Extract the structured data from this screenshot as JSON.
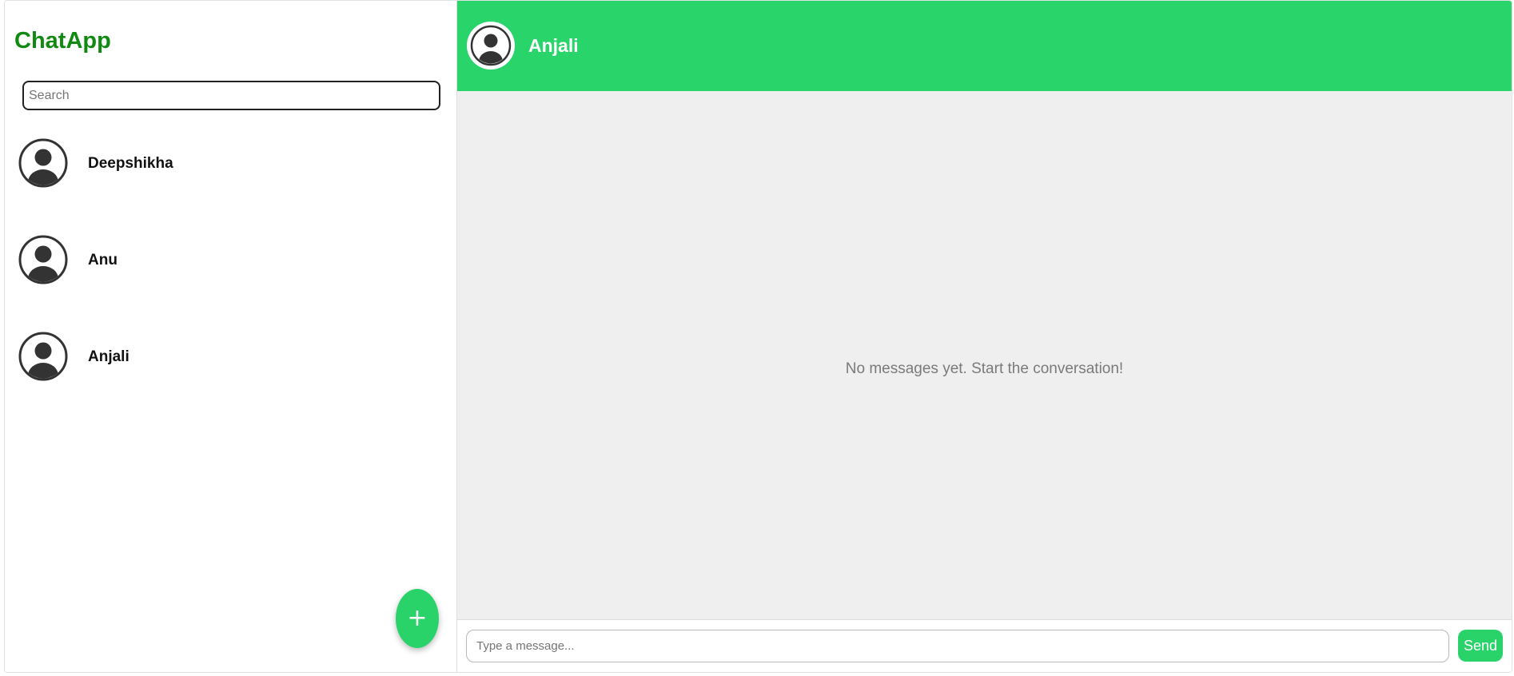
{
  "sidebar": {
    "brand": "ChatApp",
    "search_placeholder": "Search",
    "search_value": "",
    "contacts": [
      {
        "name": "Deepshikha",
        "icon": "user-avatar-icon"
      },
      {
        "name": "Anu",
        "icon": "user-avatar-icon"
      },
      {
        "name": "Anjali",
        "icon": "user-avatar-icon"
      }
    ],
    "new_chat_label": "+"
  },
  "chat": {
    "title": "Anjali",
    "avatar_icon": "user-avatar-icon",
    "empty_text": "No messages yet. Start the conversation!",
    "composer": {
      "placeholder": "Type a message...",
      "value": "",
      "send_label": "Send"
    }
  },
  "colors": {
    "brand": "#118a11",
    "accent": "#29d56a",
    "chat_background": "#efefef"
  }
}
